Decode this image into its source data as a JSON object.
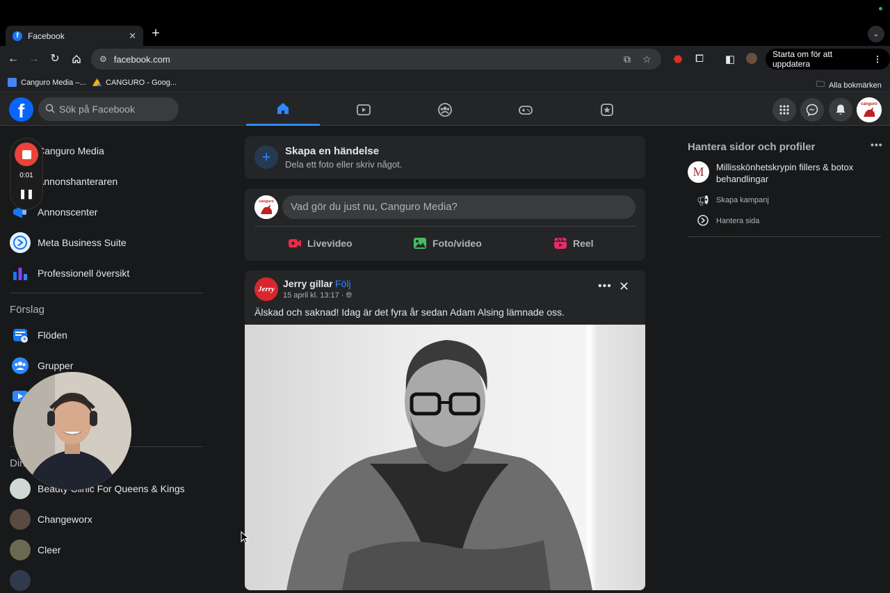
{
  "browser": {
    "tab_title": "Facebook",
    "url": "facebook.com",
    "update_button": "Starta om för att uppdatera",
    "bookmarks": [
      {
        "label": "Canguro Media –..."
      },
      {
        "label": "CANGURO - Goog..."
      }
    ],
    "all_bookmarks": "Alla bokmärken"
  },
  "header": {
    "search_placeholder": "Sök på Facebook",
    "tabs": [
      "home",
      "video",
      "groups",
      "gaming",
      "marketplace"
    ],
    "active_tab": "home"
  },
  "sidebar": {
    "items": [
      {
        "label": "Canguro Media"
      },
      {
        "label": "Annonshanteraren"
      },
      {
        "label": "Annonscenter"
      },
      {
        "label": "Meta Business Suite"
      },
      {
        "label": "Professionell översikt"
      }
    ],
    "suggestions_title": "Förslag",
    "suggestions": [
      {
        "label": "Flöden"
      },
      {
        "label": "Grupper"
      }
    ],
    "shortcuts_title": "Din",
    "shortcuts": [
      {
        "label": "Beauty Clinic For Queens & Kings"
      },
      {
        "label": "Changeworx"
      },
      {
        "label": "Cleer"
      }
    ]
  },
  "recorder": {
    "time": "0:01"
  },
  "feed": {
    "create_event": {
      "title": "Skapa en händelse",
      "subtitle": "Dela ett foto eller skriv något."
    },
    "composer": {
      "placeholder": "Vad gör du just nu, Canguro Media?",
      "actions": [
        "Livevideo",
        "Foto/video",
        "Reel"
      ]
    },
    "post": {
      "author": "Jerry gillar",
      "separator": "·",
      "follow": "Följ",
      "time": "15 april kl. 13:17 ·",
      "text": "Älskad och saknad! Idag är det fyra år sedan Adam Alsing lämnade oss.",
      "avatar_text": "Jerry"
    }
  },
  "right": {
    "title": "Hantera sidor och profiler",
    "page_name": "Millisskönhetskrypin fillers & botox behandlingar",
    "page_initial": "M",
    "actions": [
      "Skapa kampanj",
      "Hantera sida"
    ]
  },
  "colors": {
    "fb_blue": "#0866ff",
    "accent": "#2d88ff",
    "record_red": "#e9433a"
  }
}
